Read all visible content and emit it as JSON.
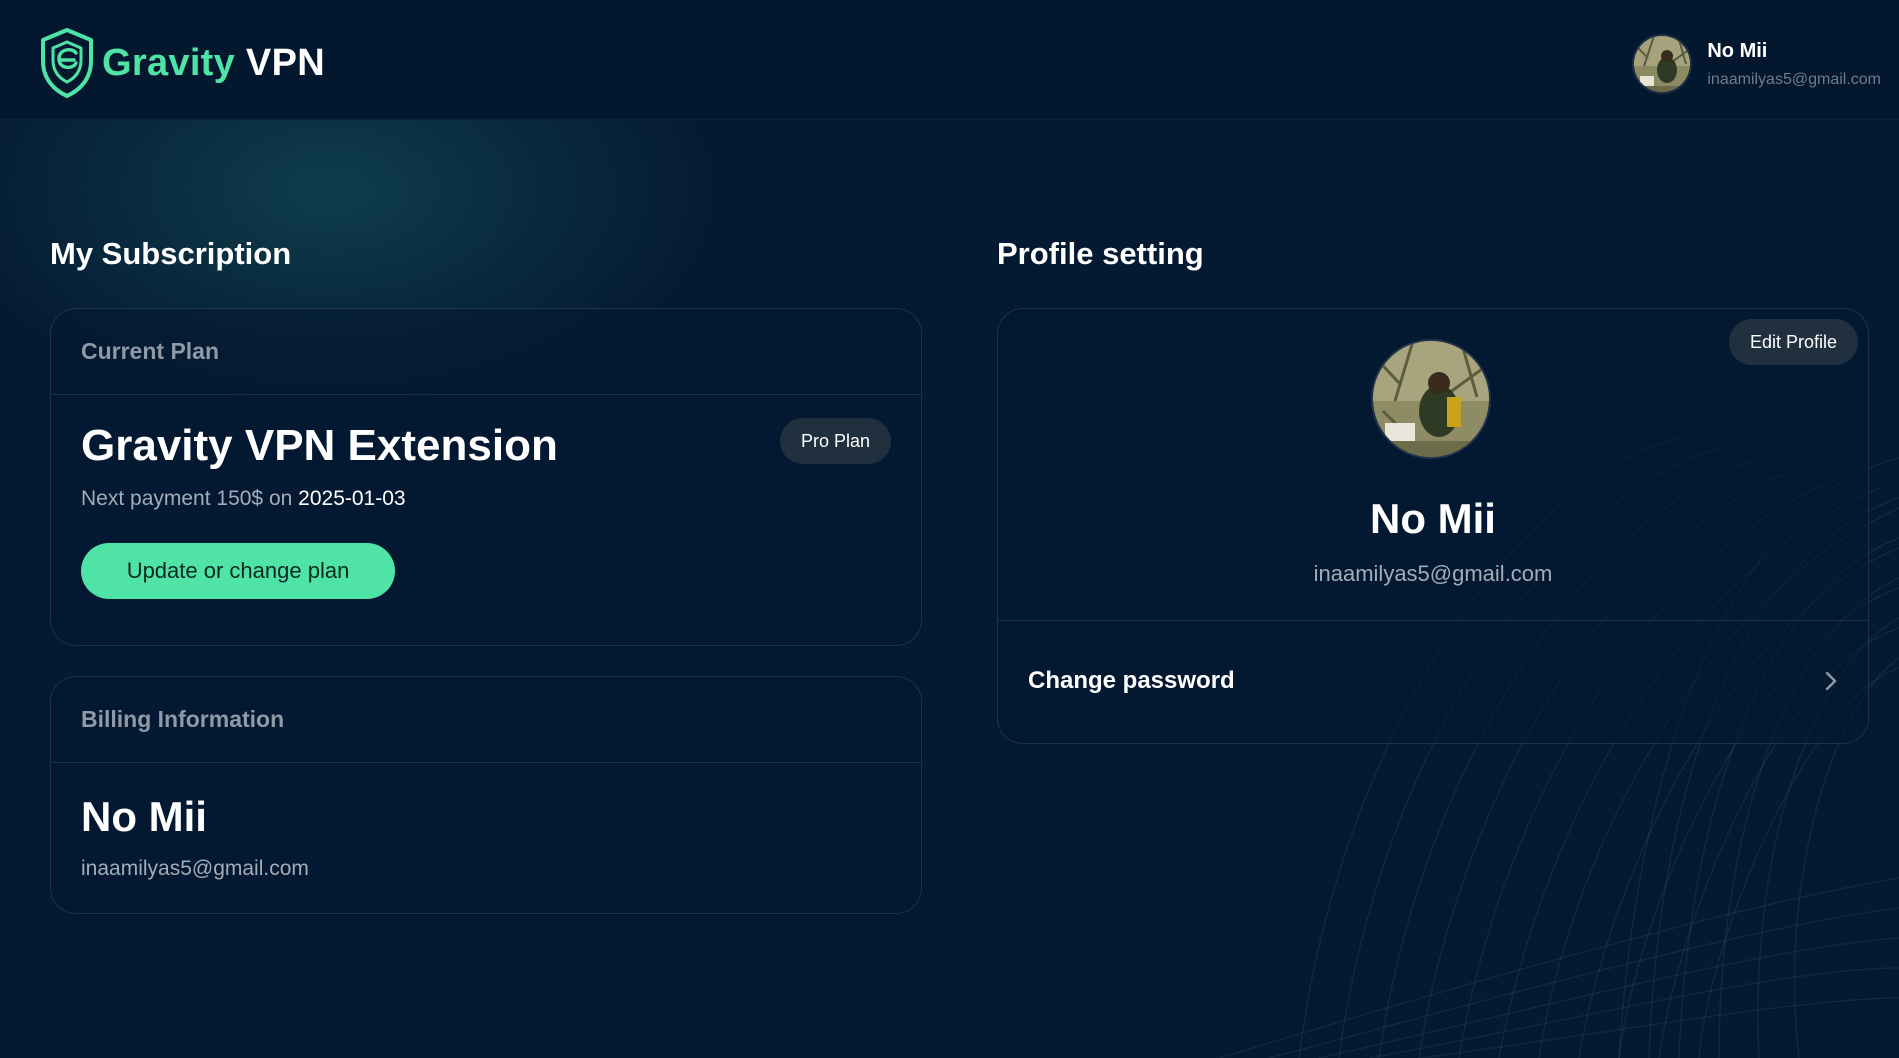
{
  "brand": {
    "name_accent": "Gravity",
    "name_main": "VPN",
    "accent_color": "#4fe3a5"
  },
  "header_user": {
    "name": "No Mii",
    "email": "inaamilyas5@gmail.com"
  },
  "subscription": {
    "section_title": "My Subscription",
    "current_plan": {
      "header": "Current Plan",
      "plan_name": "Gravity VPN Extension",
      "badge": "Pro Plan",
      "payment_prefix": "Next payment 150$ on",
      "payment_date": "2025-01-03",
      "cta_label": "Update or change plan"
    },
    "billing": {
      "header": "Billing Information",
      "name": "No Mii",
      "email": "inaamilyas5@gmail.com"
    }
  },
  "profile": {
    "section_title": "Profile setting",
    "edit_label": "Edit Profile",
    "name": "No Mii",
    "email": "inaamilyas5@gmail.com",
    "change_password_label": "Change password"
  },
  "icons": {
    "logo": "shield-logo-icon",
    "chevron": "chevron-right-icon"
  }
}
